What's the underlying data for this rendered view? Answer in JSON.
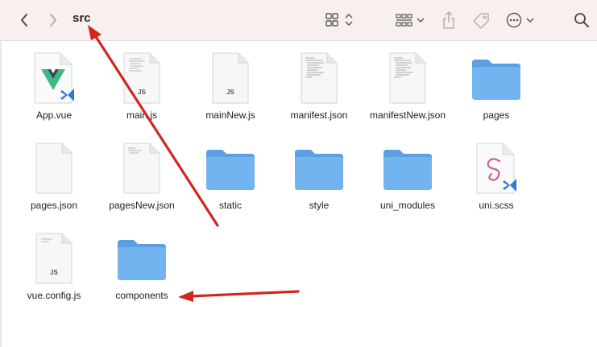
{
  "toolbar": {
    "back_icon": "chevron-left-icon",
    "forward_icon": "chevron-right-icon",
    "title": "src",
    "view_icon": "grid-view-icon",
    "group_icon": "group-by-icon",
    "share_icon": "share-icon",
    "tag_icon": "tag-icon",
    "more_icon": "ellipsis-circle-icon",
    "search_icon": "search-icon"
  },
  "files": [
    {
      "name": "App.vue",
      "kind": "vue"
    },
    {
      "name": "main.js",
      "kind": "js"
    },
    {
      "name": "mainNew.js",
      "kind": "js"
    },
    {
      "name": "manifest.json",
      "kind": "json-code"
    },
    {
      "name": "manifestNew.json",
      "kind": "json-code"
    },
    {
      "name": "pages",
      "kind": "folder"
    },
    {
      "name": "pages.json",
      "kind": "blank"
    },
    {
      "name": "pagesNew.json",
      "kind": "json-code"
    },
    {
      "name": "static",
      "kind": "folder"
    },
    {
      "name": "style",
      "kind": "folder"
    },
    {
      "name": "uni_modules",
      "kind": "folder"
    },
    {
      "name": "uni.scss",
      "kind": "scss"
    },
    {
      "name": "vue.config.js",
      "kind": "js"
    },
    {
      "name": "components",
      "kind": "folder"
    }
  ],
  "colors": {
    "arrow": "#d0271d",
    "folder_front": "#72b4f0",
    "folder_back": "#5aa0e2",
    "vscode_blue": "#2a7bd6"
  }
}
